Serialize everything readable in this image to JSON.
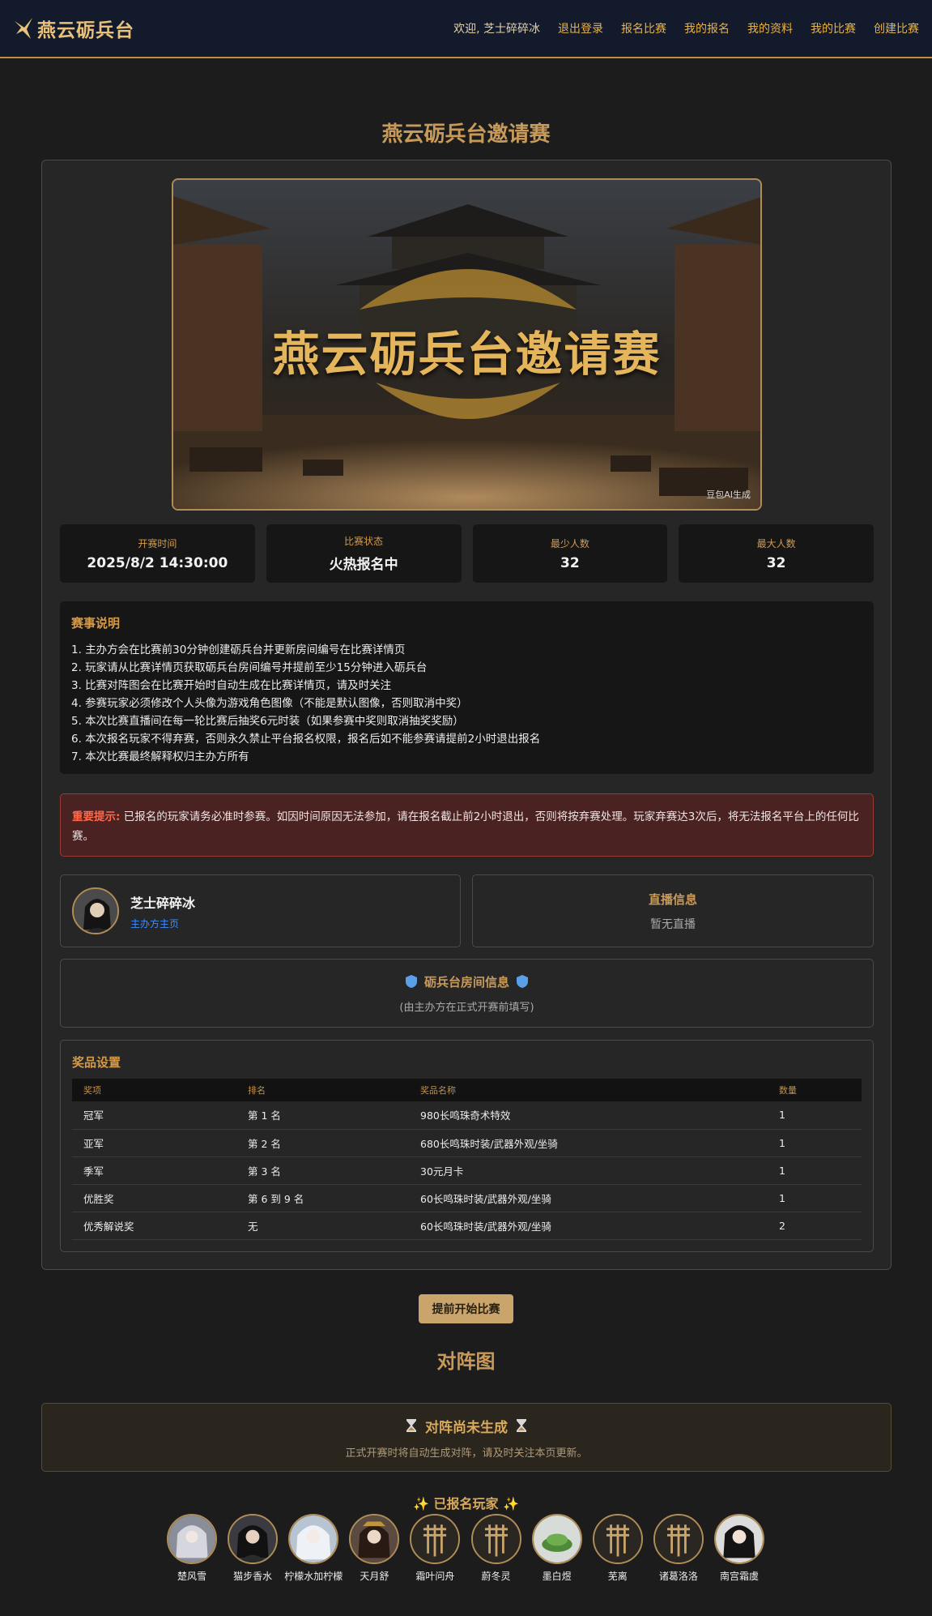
{
  "nav": {
    "logo_text": "燕云砺兵台",
    "welcome": "欢迎, 芝士碎碎冰",
    "links": [
      "退出登录",
      "报名比赛",
      "我的报名",
      "我的资料",
      "我的比赛",
      "创建比赛"
    ]
  },
  "page_title": "燕云砺兵台邀请赛",
  "banner": {
    "title": "燕云砺兵台邀请赛",
    "watermark": "豆包AI生成"
  },
  "stats": [
    {
      "label": "开赛时间",
      "value": "2025/8/2 14:30:00"
    },
    {
      "label": "比赛状态",
      "value": "火热报名中"
    },
    {
      "label": "最少人数",
      "value": "32"
    },
    {
      "label": "最大人数",
      "value": "32"
    }
  ],
  "rules": {
    "title": "赛事说明",
    "items": [
      "1. 主办方会在比赛前30分钟创建砺兵台并更新房间编号在比赛详情页",
      "2. 玩家请从比赛详情页获取砺兵台房间编号并提前至少15分钟进入砺兵台",
      "3. 比赛对阵图会在比赛开始时自动生成在比赛详情页，请及时关注",
      "4. 参赛玩家必须修改个人头像为游戏角色图像（不能是默认图像，否则取消中奖）",
      "5. 本次比赛直播间在每一轮比赛后抽奖6元时装（如果参赛中奖则取消抽奖奖励）",
      "6. 本次报名玩家不得弃赛，否则永久禁止平台报名权限，报名后如不能参赛请提前2小时退出报名",
      "7. 本次比赛最终解释权归主办方所有"
    ]
  },
  "warning": {
    "label": "重要提示:",
    "text": "已报名的玩家请务必准时参赛。如因时间原因无法参加，请在报名截止前2小时退出，否则将按弃赛处理。玩家弃赛达3次后，将无法报名平台上的任何比赛。"
  },
  "host": {
    "name": "芝士碎碎冰",
    "link": "主办方主页"
  },
  "live": {
    "title": "直播信息",
    "value": "暂无直播"
  },
  "room": {
    "title": "砺兵台房间信息",
    "subtitle": "(由主办方在正式开赛前填写)"
  },
  "prizes": {
    "title": "奖品设置",
    "headers": [
      "奖项",
      "排名",
      "奖品名称",
      "数量"
    ],
    "rows": [
      [
        "冠军",
        "第 1 名",
        "980长鸣珠奇术特效",
        "1"
      ],
      [
        "亚军",
        "第 2 名",
        "680长鸣珠时装/武器外观/坐骑",
        "1"
      ],
      [
        "季军",
        "第 3 名",
        "30元月卡",
        "1"
      ],
      [
        "优胜奖",
        "第 6 到 9 名",
        "60长鸣珠时装/武器外观/坐骑",
        "1"
      ],
      [
        "优秀解说奖",
        "无",
        "60长鸣珠时装/武器外观/坐骑",
        "2"
      ]
    ]
  },
  "start_button": "提前开始比赛",
  "bracket": {
    "title": "对阵图",
    "main": "对阵尚未生成",
    "sub": "正式开赛时将自动生成对阵，请及时关注本页更新。"
  },
  "players": {
    "title": "已报名玩家",
    "list": [
      {
        "name": "楚风雪",
        "avatar": "portrait-silver"
      },
      {
        "name": "猫步香水",
        "avatar": "portrait-dark"
      },
      {
        "name": "柠檬水加柠檬",
        "avatar": "portrait-white"
      },
      {
        "name": "天月舒",
        "avatar": "portrait-ornate"
      },
      {
        "name": "霜叶问舟",
        "avatar": "default-emblem"
      },
      {
        "name": "蔚冬灵",
        "avatar": "default-emblem"
      },
      {
        "name": "墨白煜",
        "avatar": "plant"
      },
      {
        "name": "芜离",
        "avatar": "default-emblem"
      },
      {
        "name": "诸葛洛洛",
        "avatar": "default-emblem"
      },
      {
        "name": "南宫霜虞",
        "avatar": "portrait-dark"
      }
    ]
  }
}
